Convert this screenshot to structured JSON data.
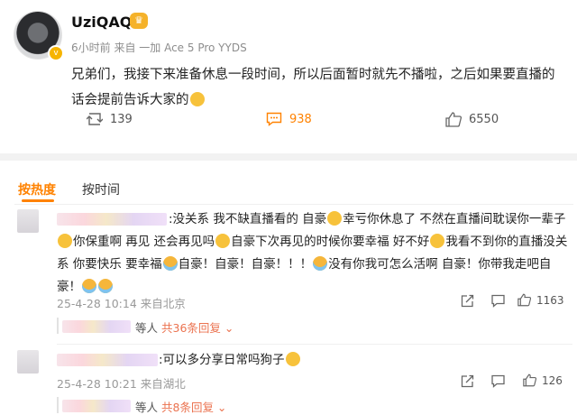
{
  "post": {
    "username": "UziQAQ",
    "meta": "6小时前  来自 一加 Ace 5 Pro YYDS",
    "text": "兄弟们，我接下来准备休息一段时间，所以后面暂时就先不播啦，之后如果要直播的话会提前告诉大家的",
    "reposts": "139",
    "comments": "938",
    "likes": "6550"
  },
  "sort_tabs": [
    {
      "label": "按热度"
    },
    {
      "label": "按时间"
    }
  ],
  "comments": [
    {
      "lines": [
        ":没关系 我不缺直播看的 自豪",
        "幸亏你休息了 不然在直播间耽误你一辈子",
        "你保重啊 再见 还会再见吗",
        "自豪下次再见的时候你要幸福 好不好",
        "我看不到你的直播没关",
        "系 你要快乐 要幸福",
        "自豪！自豪！自豪！！！",
        "没有你我可怎么活啊 自豪！你带我走吧自",
        "豪！"
      ],
      "meta": "25-4-28 10:14 来自北京",
      "likes": "1163",
      "replies_prefix": "等人",
      "replies_link": "共36条回复"
    },
    {
      "text": ":可以多分享日常吗狗子",
      "meta": "25-4-28 10:21 来自湖北",
      "likes": "126",
      "replies_prefix": "等人",
      "replies_link": "共8条回复"
    }
  ],
  "colors": {
    "accent": "#ff8200",
    "link": "#eb7350"
  }
}
